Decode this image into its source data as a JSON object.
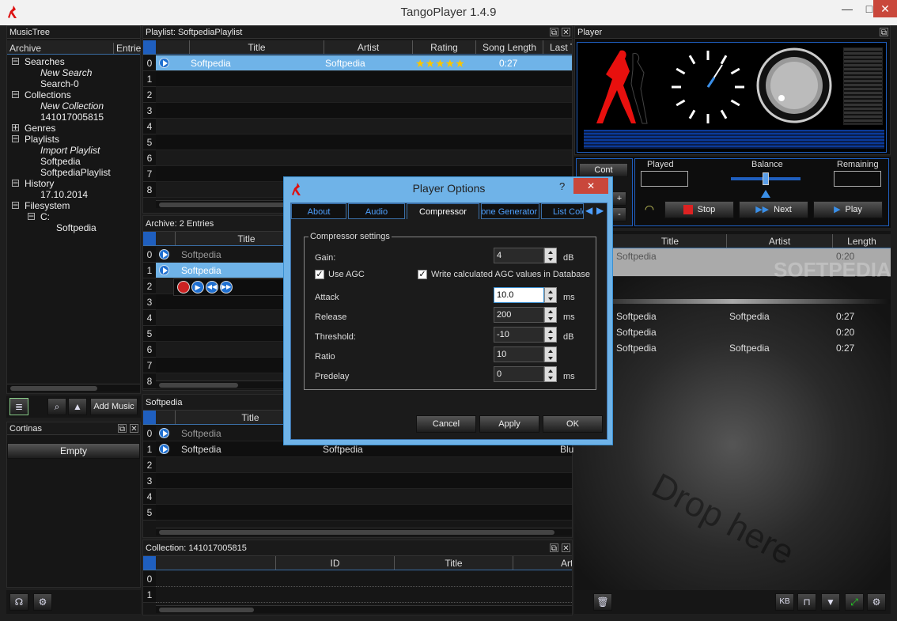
{
  "window": {
    "title": "TangoPlayer 1.4.9",
    "min_label": "—",
    "max_label": "□",
    "close_label": "✕"
  },
  "musictree": {
    "title": "MusicTree",
    "col_archive": "Archive",
    "col_entries": "Entrie",
    "items": [
      {
        "label": "Searches",
        "toggle": "−"
      },
      {
        "label": "New Search"
      },
      {
        "label": "Search-0"
      },
      {
        "label": "Collections",
        "toggle": "−"
      },
      {
        "label": "New Collection"
      },
      {
        "label": "141017005815"
      },
      {
        "label": "Genres",
        "toggle": "+"
      },
      {
        "label": "Playlists",
        "toggle": "−"
      },
      {
        "label": "Import Playlist"
      },
      {
        "label": "Softpedia"
      },
      {
        "label": "SoftpediaPlaylist"
      },
      {
        "label": "History",
        "toggle": "−"
      },
      {
        "label": "17.10.2014"
      },
      {
        "label": "Filesystem",
        "toggle": "−"
      },
      {
        "label": "C:",
        "toggle": "−"
      },
      {
        "label": "Softpedia"
      }
    ],
    "add_music_label": "Add Music"
  },
  "cortinas": {
    "title": "Cortinas",
    "empty_label": "Empty"
  },
  "playlist": {
    "title": "Playlist: SoftpediaPlaylist",
    "columns": [
      "Title",
      "Artist",
      "Rating",
      "Song Length",
      "Last T"
    ],
    "row0": {
      "title": "Softpedia",
      "artist": "Softpedia",
      "stars": "★★★★★",
      "length": "0:27"
    },
    "row_numbers": [
      "0",
      "1",
      "2",
      "3",
      "4",
      "5",
      "6",
      "7",
      "8"
    ]
  },
  "archive": {
    "title": "Archive:  2  Entries",
    "col_title": "Title",
    "rows": [
      "Softpedia",
      "Softpedia"
    ],
    "row_numbers": [
      "0",
      "1",
      "2",
      "3",
      "4",
      "5",
      "6",
      "7",
      "8"
    ]
  },
  "softpedia_list": {
    "title": "Softpedia",
    "col_title": "Title",
    "rows": [
      {
        "title": "Softpedia",
        "artist": "",
        "extra": ""
      },
      {
        "title": "Softpedia",
        "artist": "Softpedia",
        "extra": "Blu"
      }
    ],
    "row_numbers": [
      "0",
      "1",
      "2",
      "3",
      "4",
      "5"
    ]
  },
  "collection": {
    "title": "Collection: 141017005815",
    "columns": [
      "ID",
      "Title",
      "Art"
    ],
    "row_numbers": [
      "0",
      "1"
    ]
  },
  "player": {
    "title": "Player",
    "cont_label": "Cont",
    "plus_label": "+",
    "minus_label": "-",
    "played_label": "Played",
    "balance_label": "Balance",
    "remaining_label": "Remaining",
    "stop_label": "Stop",
    "next_label": "Next",
    "play_label": "Play",
    "queue_columns": [
      "Title",
      "Artist",
      "Length"
    ],
    "queue_current": {
      "title": "Softpedia",
      "length": "0:20"
    },
    "queue_rows": [
      {
        "title": "Softpedia",
        "artist": "Softpedia",
        "length": "0:27"
      },
      {
        "title": "Softpedia",
        "artist": "",
        "length": "0:20"
      },
      {
        "title": "Softpedia",
        "artist": "Softpedia",
        "length": "0:27"
      }
    ],
    "drop_text": "Drop here",
    "watermark": "SOFTPEDIA",
    "kb_label": "KB"
  },
  "dialog": {
    "title": "Player Options",
    "help": "?",
    "close": "✕",
    "tabs": [
      "About",
      "Audio",
      "Compressor",
      "Tone Generator",
      "List Colo"
    ],
    "group_title": "Compressor settings",
    "gain_label": "Gain:",
    "gain_value": "4",
    "gain_unit": "dB",
    "use_agc_label": "Use AGC",
    "write_agc_label": "Write calculated AGC values in Database",
    "attack_label": "Attack",
    "attack_value": "10.0",
    "attack_unit": "ms",
    "release_label": "Release",
    "release_value": "200",
    "release_unit": "ms",
    "threshold_label": "Threshold:",
    "threshold_value": "-10",
    "threshold_unit": "dB",
    "ratio_label": "Ratio",
    "ratio_value": "10",
    "predelay_label": "Predelay",
    "predelay_value": "0",
    "predelay_unit": "ms",
    "cancel_label": "Cancel",
    "apply_label": "Apply",
    "ok_label": "OK"
  }
}
